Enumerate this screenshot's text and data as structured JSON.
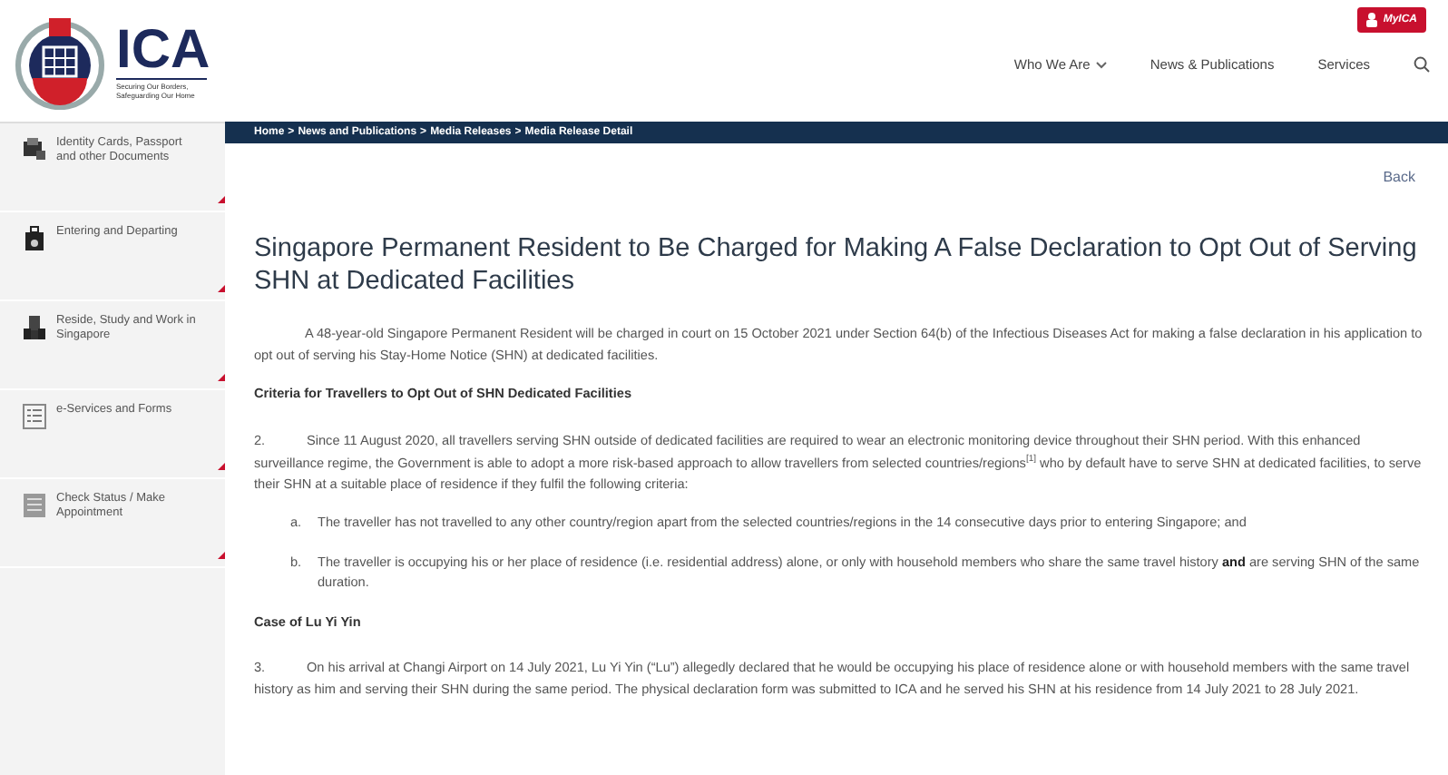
{
  "header": {
    "logo_text": "ICA",
    "tagline": "Securing Our Borders, Safeguarding Our Home",
    "mylca": "MyICA",
    "nav": [
      {
        "label": "Who We Are",
        "dropdown": true
      },
      {
        "label": "News & Publications",
        "dropdown": false
      },
      {
        "label": "Services",
        "dropdown": false
      }
    ]
  },
  "sidebar": {
    "items": [
      {
        "label": "Identity Cards, Passport and other Documents"
      },
      {
        "label": "Entering and Departing"
      },
      {
        "label": "Reside, Study and Work in Singapore"
      },
      {
        "label": "e-Services and Forms"
      },
      {
        "label": "Check Status / Make Appointment"
      }
    ]
  },
  "breadcrumb": [
    {
      "label": "Home",
      "separator": ">"
    },
    {
      "label": "News and Publications",
      "separator": ">"
    },
    {
      "label": "Media Releases",
      "separator": ">"
    },
    {
      "label": "Media Release Detail"
    }
  ],
  "back": "Back",
  "title": "Singapore Permanent Resident to Be Charged for Making A False Declaration to Opt Out of Serving SHN at Dedicated Facilities",
  "body": [
    {
      "kind": "para",
      "text": "A 48-year-old Singapore Permanent Resident will be charged in court on 15 October 2021 under Section 64(b) of the Infectious Diseases Act for making a false declaration in his application to opt out of serving his Stay-Home Notice (SHN) at dedicated facilities."
    },
    {
      "kind": "heading",
      "text": "Criteria for Travellers to Opt Out of SHN Dedicated Facilities"
    },
    {
      "kind": "para",
      "number": "2.",
      "text": "Since 11 August 2020, all travellers serving SHN outside of dedicated facilities are required to wear an electronic monitoring device throughout their SHN period. With this enhanced surveillance regime, the Government is able to adopt a more risk-based approach to allow travellers from selected countries/regions$^{[1]}$ who by default have to serve SHN at dedicated facilities, to serve their SHN at a suitable place of residence if they fulfil the following criteria:"
    },
    {
      "kind": "item",
      "number": "a.",
      "text": "The traveller has not travelled to any other country/region apart from the selected countries/regions in the 14 consecutive days prior to entering Singapore; and"
    },
    {
      "kind": "item",
      "number": "b.",
      "text": "The traveller is occupying his or her place of residence (i.e. residential address) alone, or only with household members who share the same travel history **and** are serving SHN of the same duration."
    },
    {
      "kind": "heading",
      "text": "Case of Lu Yi Yin"
    },
    {
      "kind": "para",
      "number": "3.",
      "text": "On his arrival at Changi Airport on 14 July 2021, Lu Yi Yin (“Lu”) allegedly declared that he would be occupying his place of residence alone or with household members with the same travel history as him and serving their SHN during the same period. The physical declaration form was submitted to ICA and he served his SHN at his residence from 14 July 2021 to 28 July 2021."
    }
  ]
}
